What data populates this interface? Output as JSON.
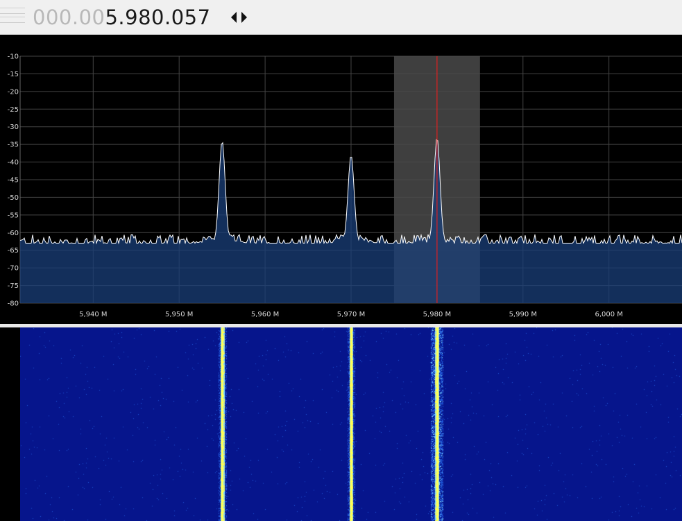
{
  "frequency": {
    "dim_digits": "000.00",
    "bright_digits": "5.980.057"
  },
  "spectrum": {
    "y_axis_labels": [
      "-10",
      "-15",
      "-20",
      "-25",
      "-30",
      "-35",
      "-40",
      "-45",
      "-50",
      "-55",
      "-60",
      "-65",
      "-70",
      "-75",
      "-80"
    ],
    "x_axis_labels": [
      "5,940 M",
      "5,950 M",
      "5,960 M",
      "5,970 M",
      "5,980 M",
      "5,990 M",
      "6,000 M"
    ],
    "y_range_db": [
      -80,
      -10
    ],
    "x_range_mhz": [
      5.9315,
      6.0085
    ],
    "noise_floor_db": -63,
    "peaks": [
      {
        "freq_mhz": 5.955,
        "level_db": -34
      },
      {
        "freq_mhz": 5.97,
        "level_db": -38
      },
      {
        "freq_mhz": 5.98,
        "level_db": -33
      }
    ],
    "passband_mhz": [
      5.975,
      5.985
    ],
    "tuned_freq_mhz": 5.98,
    "colors": {
      "grid": "#444444",
      "trace": "#ffffff",
      "fill": "#1a3f7a",
      "passband": "#4a4a4a",
      "marker": "#e02020"
    }
  },
  "waterfall": {
    "carriers_mhz": [
      5.955,
      5.97,
      5.98
    ],
    "colors": [
      "#06158c",
      "#1f55d8",
      "#7fd8ff",
      "#ffff55",
      "#ff3010"
    ]
  }
}
